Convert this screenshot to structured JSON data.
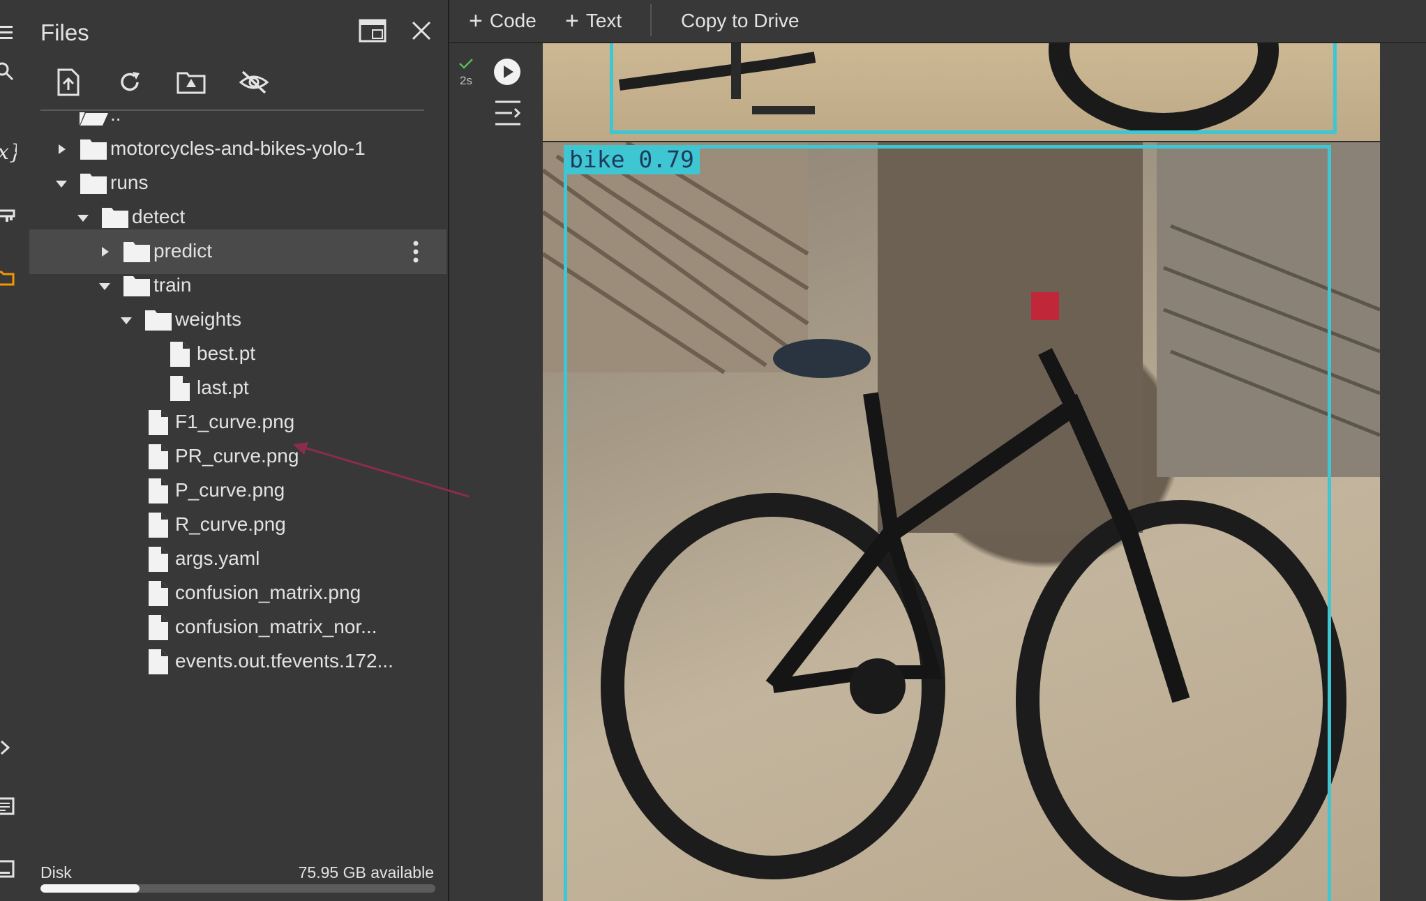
{
  "files_panel": {
    "title": "Files",
    "tree": [
      {
        "label": "..",
        "kind": "parent-folder",
        "depth": 0,
        "expander": "none"
      },
      {
        "label": "motorcycles-and-bikes-yolo-1",
        "kind": "folder",
        "depth": 0,
        "expander": "collapsed"
      },
      {
        "label": "runs",
        "kind": "folder",
        "depth": 0,
        "expander": "expanded"
      },
      {
        "label": "detect",
        "kind": "folder",
        "depth": 1,
        "expander": "expanded"
      },
      {
        "label": "predict",
        "kind": "folder",
        "depth": 2,
        "expander": "collapsed",
        "selected": true
      },
      {
        "label": "train",
        "kind": "folder",
        "depth": 2,
        "expander": "expanded"
      },
      {
        "label": "weights",
        "kind": "folder",
        "depth": 3,
        "expander": "expanded"
      },
      {
        "label": "best.pt",
        "kind": "file",
        "depth": 4,
        "expander": "none"
      },
      {
        "label": "last.pt",
        "kind": "file",
        "depth": 4,
        "expander": "none"
      },
      {
        "label": "F1_curve.png",
        "kind": "file",
        "depth": 3,
        "expander": "none"
      },
      {
        "label": "PR_curve.png",
        "kind": "file",
        "depth": 3,
        "expander": "none"
      },
      {
        "label": "P_curve.png",
        "kind": "file",
        "depth": 3,
        "expander": "none"
      },
      {
        "label": "R_curve.png",
        "kind": "file",
        "depth": 3,
        "expander": "none"
      },
      {
        "label": "args.yaml",
        "kind": "file",
        "depth": 3,
        "expander": "none"
      },
      {
        "label": "confusion_matrix.png",
        "kind": "file",
        "depth": 3,
        "expander": "none"
      },
      {
        "label": "confusion_matrix_nor...",
        "kind": "file",
        "depth": 3,
        "expander": "none"
      },
      {
        "label": "events.out.tfevents.172...",
        "kind": "file",
        "depth": 3,
        "expander": "none"
      }
    ],
    "disk": {
      "label": "Disk",
      "available": "75.95 GB available",
      "used_fraction": 0.25
    }
  },
  "toolbar": {
    "code_label": "Code",
    "text_label": "Text",
    "copy_label": "Copy to Drive"
  },
  "cell": {
    "run_time": "2s"
  },
  "output": {
    "detection_label": "bike 0.79"
  },
  "colors": {
    "bbox": "#3fc6d3",
    "annotation_arrow": "#8a2d4a",
    "run_check": "#5cb85c"
  }
}
